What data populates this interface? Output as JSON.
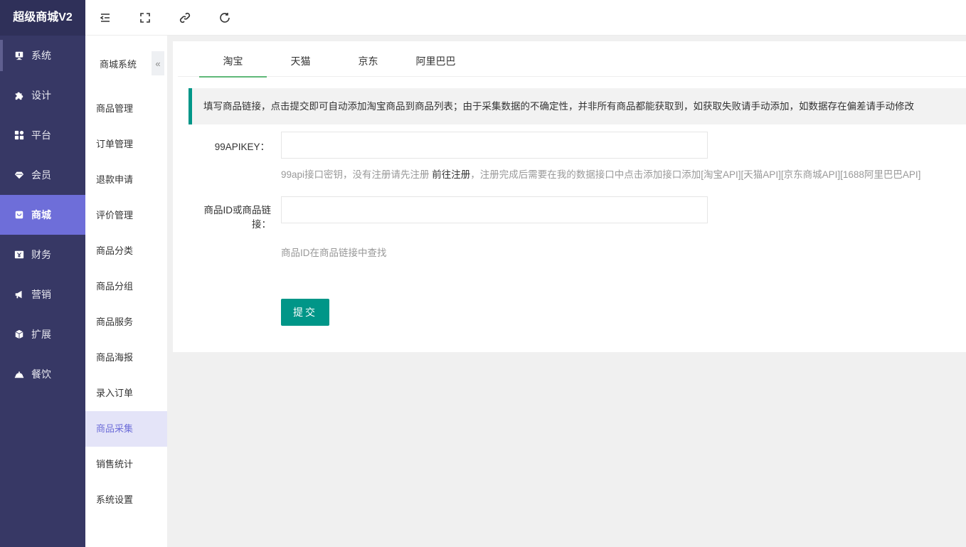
{
  "brand": "超级商城V2",
  "sidebar": {
    "items": [
      {
        "label": "系统",
        "icon": "system-icon"
      },
      {
        "label": "设计",
        "icon": "puzzle-icon"
      },
      {
        "label": "平台",
        "icon": "grid-icon"
      },
      {
        "label": "会员",
        "icon": "diamond-icon"
      },
      {
        "label": "商城",
        "icon": "shopping-bag-icon"
      },
      {
        "label": "财务",
        "icon": "yen-icon"
      },
      {
        "label": "营销",
        "icon": "megaphone-icon"
      },
      {
        "label": "扩展",
        "icon": "cube-icon"
      },
      {
        "label": "餐饮",
        "icon": "cloche-icon"
      }
    ],
    "active": "商城"
  },
  "topbar": {
    "icons": [
      "menu-collapse-icon",
      "fullscreen-icon",
      "link-icon",
      "refresh-icon"
    ]
  },
  "subnav": {
    "title": "商城系统",
    "collapse": "«",
    "items": [
      "商品管理",
      "订单管理",
      "退款申请",
      "评价管理",
      "商品分类",
      "商品分组",
      "商品服务",
      "商品海报",
      "录入订单",
      "商品采集",
      "销售统计",
      "系统设置"
    ],
    "active": "商品采集"
  },
  "tabs": [
    "淘宝",
    "天猫",
    "京东",
    "阿里巴巴"
  ],
  "active_tab": "淘宝",
  "notice": "填写商品链接，点击提交即可自动添加淘宝商品到商品列表；由于采集数据的不确定性，并非所有商品都能获取到，如获取失败请手动添加，如数据存在偏差请手动修改",
  "form": {
    "apikey_label": "99APIKEY：",
    "apikey_value": "",
    "apikey_help_prefix": "99api接口密钥，没有注册请先注册 ",
    "apikey_help_link": "前往注册",
    "apikey_help_suffix": "，注册完成后需要在我的数据接口中点击添加接口添加[淘宝API][天猫API][京东商城API][1688阿里巴巴API]",
    "goods_label_line1": "商品ID或商品链",
    "goods_label_line2": "接：",
    "goods_value": "",
    "goods_help": "商品ID在商品链接中查找",
    "submit_label": "提交"
  },
  "colors": {
    "sidebar_bg": "#373865",
    "active_purple": "#6e6ed9",
    "primary_teal": "#009688",
    "tab_underline": "#5fb878"
  }
}
